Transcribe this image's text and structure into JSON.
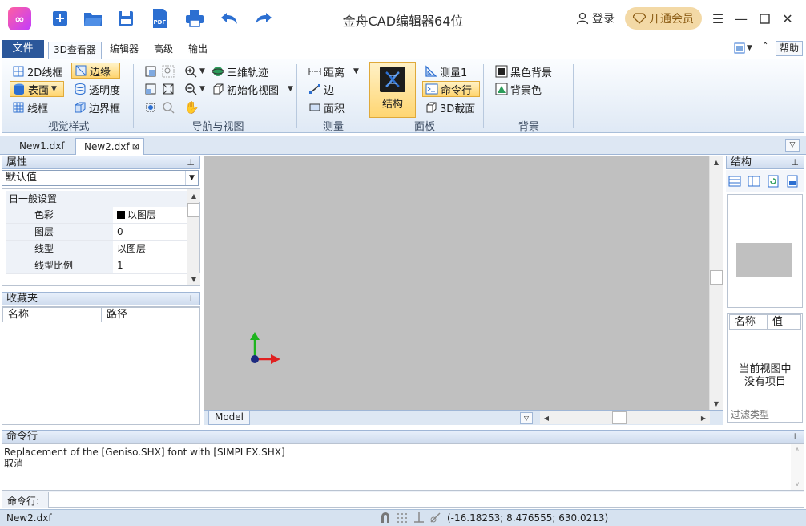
{
  "app": {
    "title": "金舟CAD编辑器64位",
    "login_label": "登录",
    "vip_label": "开通会员"
  },
  "ribbon": {
    "file_tab": "文件",
    "tabs": [
      "3D查看器",
      "编辑器",
      "高级",
      "输出"
    ],
    "help_label": "帮助",
    "groups": {
      "visual_style": {
        "label": "视觉样式",
        "wire2d": "2D线框",
        "edge": "边缘",
        "surface": "表面",
        "transparency": "透明度",
        "wireframe": "线框",
        "bbox": "边界框"
      },
      "nav": {
        "label": "导航与视图",
        "orbit3d": "三维轨迹",
        "init_view": "初始化视图"
      },
      "measure": {
        "label": "测量",
        "distance": "距离",
        "edge": "边",
        "area": "面积"
      },
      "panel": {
        "label": "面板",
        "structure": "结构",
        "measure1": "测量1",
        "cmdline": "命令行",
        "section3d": "3D截面"
      },
      "background": {
        "label": "背景",
        "black_bg": "黑色背景",
        "bg_color": "背景色"
      }
    }
  },
  "doc_tabs": [
    "New1.dxf",
    "New2.dxf"
  ],
  "properties": {
    "title": "属性",
    "dropdown_value": "默认值",
    "section": "日一般设置",
    "rows": [
      {
        "key": "色彩",
        "value": "以图层"
      },
      {
        "key": "图层",
        "value": "0"
      },
      {
        "key": "线型",
        "value": "以图层"
      },
      {
        "key": "线型比例",
        "value": "1"
      }
    ]
  },
  "favorites": {
    "title": "收藏夹",
    "col_name": "名称",
    "col_path": "路径"
  },
  "model_tab": "Model",
  "structure_panel": {
    "title": "结构",
    "col_name": "名称",
    "col_value": "值",
    "empty_msg_1": "当前视图中",
    "empty_msg_2": "没有项目",
    "filter_placeholder": "过滤类型"
  },
  "command": {
    "title": "命令行",
    "output_lines": [
      "Replacement of the [Geniso.SHX] font with [SIMPLEX.SHX]",
      "取消"
    ],
    "input_label": "命令行:"
  },
  "status": {
    "filename": "New2.dxf",
    "coords": "(-16.18253; 8.476555; 630.0213)"
  }
}
